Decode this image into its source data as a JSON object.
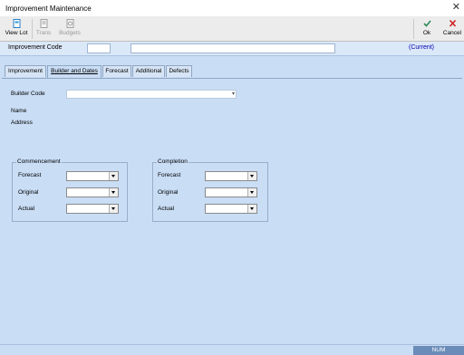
{
  "window": {
    "title": "Improvement Maintenance"
  },
  "toolbar": {
    "view_lot": "View Lot",
    "trans": "Trans",
    "budgets": "Budgets",
    "ok": "Ok",
    "cancel": "Cancel"
  },
  "codebar": {
    "label": "Improvement Code",
    "code_value": "",
    "description_value": "",
    "status": "(Current)"
  },
  "tabs": [
    "Improvement",
    "Builder and Dates",
    "Forecast",
    "Additional",
    "Defects"
  ],
  "active_tab": "Builder and Dates",
  "builder": {
    "code_label": "Builder Code",
    "code_value": "",
    "name_label": "Name",
    "address_label": "Address"
  },
  "commencement": {
    "title": "Commencement",
    "forecast_label": "Forecast",
    "original_label": "Original",
    "actual_label": "Actual"
  },
  "completion": {
    "title": "Completion",
    "forecast_label": "Forecast",
    "original_label": "Original",
    "actual_label": "Actual"
  },
  "statusbar": {
    "num": "NUM"
  },
  "colors": {
    "accent_ok": "#2e8b57",
    "accent_cancel": "#cc2222",
    "status_link": "#0000b0"
  }
}
